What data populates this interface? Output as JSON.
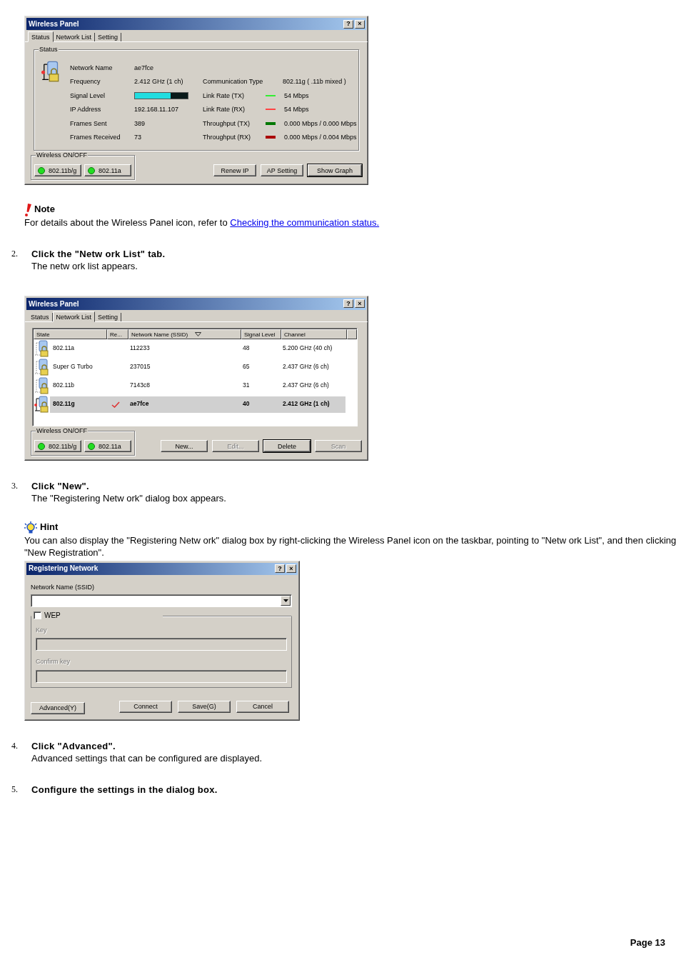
{
  "content": [
    {
      "kind": "status_dialog",
      "title": "Wireless Panel",
      "help_button": "?",
      "close_button": "×",
      "tabs": [
        {
          "label": "Status",
          "selected": true
        },
        {
          "label": "Network List",
          "selected": false
        },
        {
          "label": "Setting",
          "selected": false
        }
      ],
      "group_title": "Status",
      "left_fields": [
        {
          "kind": "text",
          "label": "Network Name",
          "value": "ae7fce"
        },
        {
          "kind": "text",
          "label": "Frequency",
          "value": "2.412 GHz (1 ch)"
        },
        {
          "kind": "meter",
          "label": "Signal Level",
          "level": 0.67
        },
        {
          "kind": "text",
          "label": "IP Address",
          "value": "192.168.11.107"
        },
        {
          "kind": "text",
          "label": "Frames Sent",
          "value": "389"
        },
        {
          "kind": "text",
          "label": "Frames Received",
          "value": "73"
        }
      ],
      "right_fields": [
        {
          "kind": "text",
          "label": "Communication Type",
          "value": "802.11g ( .11b mixed )"
        },
        {
          "kind": "thin_line",
          "label": "Link Rate (TX)",
          "color": "#33ee33",
          "value": "54 Mbps"
        },
        {
          "kind": "thin_line",
          "label": "Link Rate (RX)",
          "color": "#ff4444",
          "value": "54 Mbps"
        },
        {
          "kind": "thick_line",
          "label": "Throughput (TX)",
          "color": "#007700",
          "value": "0.000 Mbps / 0.000 Mbps"
        },
        {
          "kind": "thick_line",
          "label": "Throughput (RX)",
          "color": "#aa0000",
          "value": "0.000 Mbps / 0.004 Mbps"
        }
      ],
      "wireless": {
        "title": "Wireless ON/OFF",
        "switches": [
          {
            "label": "802.11b/g",
            "on": true
          },
          {
            "label": "802.11a",
            "on": true
          }
        ]
      },
      "buttons": [
        {
          "label": "Renew IP",
          "default": false,
          "disabled": false
        },
        {
          "label": "AP Setting",
          "default": false,
          "disabled": false
        },
        {
          "label": "Show Graph",
          "default": true,
          "disabled": false
        }
      ]
    },
    {
      "kind": "note",
      "title": "Note",
      "text": "For details about the Wireless Panel icon, refer to ",
      "link": "Checking the communication status."
    },
    {
      "kind": "step",
      "number": "2.",
      "title": "Click the \"Netw ork List\" tab.",
      "description": "The netw ork list appears."
    },
    {
      "kind": "list_dialog",
      "title": "Wireless Panel",
      "help_button": "?",
      "close_button": "×",
      "tabs": [
        {
          "label": "Status",
          "selected": false
        },
        {
          "label": "Network List",
          "selected": true
        },
        {
          "label": "Setting",
          "selected": false
        }
      ],
      "columns": [
        {
          "label": "State",
          "sorted": false
        },
        {
          "label": "Re...",
          "sorted": false
        },
        {
          "label": "Network Name (SSID)",
          "sorted": true
        },
        {
          "label": "Signal Level",
          "sorted": false
        },
        {
          "label": "Channel",
          "sorted": false
        }
      ],
      "rows": [
        {
          "state": "802.11a",
          "registered": false,
          "ssid": "112233",
          "signal": "48",
          "channel": "5.200 GHz (40 ch)",
          "connected": false,
          "selected": false
        },
        {
          "state": "Super G Turbo",
          "registered": false,
          "ssid": "237015",
          "signal": "65",
          "channel": "2.437 GHz (6 ch)",
          "connected": false,
          "selected": false
        },
        {
          "state": "802.11b",
          "registered": false,
          "ssid": "7143c8",
          "signal": "31",
          "channel": "2.437 GHz (6 ch)",
          "connected": false,
          "selected": false
        },
        {
          "state": "802.11g",
          "registered": true,
          "ssid": "ae7fce",
          "signal": "40",
          "channel": "2.412 GHz (1 ch)",
          "connected": true,
          "selected": true
        }
      ],
      "wireless": {
        "title": "Wireless ON/OFF",
        "switches": [
          {
            "label": "802.11b/g",
            "on": true
          },
          {
            "label": "802.11a",
            "on": true
          }
        ]
      },
      "buttons": [
        {
          "label": "New...",
          "default": false,
          "disabled": false
        },
        {
          "label": "Edit...",
          "default": false,
          "disabled": true
        },
        {
          "label": "Delete",
          "default": true,
          "disabled": false
        },
        {
          "label": "Scan",
          "default": false,
          "disabled": true
        }
      ]
    },
    {
      "kind": "step",
      "number": "3.",
      "title": "Click \"New\".",
      "description": "The \"Registering Netw ork\" dialog box appears."
    },
    {
      "kind": "hint",
      "title": "Hint",
      "text": "You can also display the \"Registering Netw ork\" dialog box by right-clicking the Wireless Panel icon on the taskbar, pointing to \"Netw ork List\", and then clicking \"New  Registration\"."
    },
    {
      "kind": "register_dialog",
      "title": "Registering Network",
      "help_button": "?",
      "close_button": "×",
      "name_label": "Network Name (SSID)",
      "wep": {
        "label": "WEP",
        "checked": false
      },
      "fields": [
        {
          "label": "Key",
          "disabled": true
        },
        {
          "label": "Confirm key",
          "disabled": true
        }
      ],
      "left_buttons": [
        {
          "label": "Advanced(Y)",
          "default": false,
          "disabled": false
        }
      ],
      "buttons": [
        {
          "label": "Connect",
          "default": false,
          "disabled": false
        },
        {
          "label": "Save(G)",
          "default": false,
          "disabled": false
        },
        {
          "label": "Cancel",
          "default": false,
          "disabled": false
        }
      ]
    },
    {
      "kind": "step",
      "number": "4.",
      "title": "Click \"Advanced\".",
      "description": "Advanced settings that can be configured are displayed."
    },
    {
      "kind": "step",
      "number": "5.",
      "title": "Configure the settings in the dialog box."
    }
  ],
  "footer": {
    "page": "Page 13"
  }
}
